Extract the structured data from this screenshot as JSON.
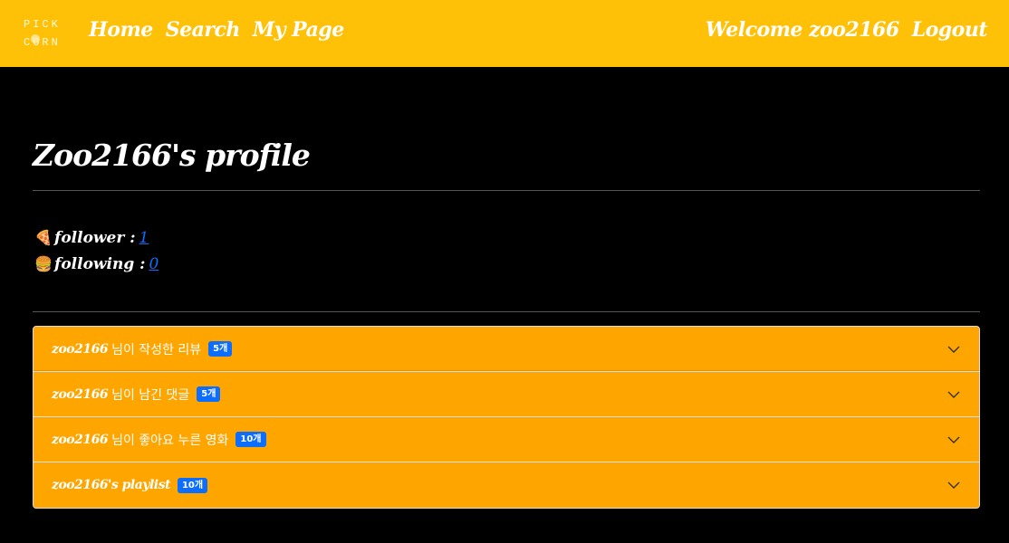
{
  "navbar": {
    "logo_text": "PICK CORN",
    "home": "Home",
    "search": "Search",
    "my_page": "My Page",
    "welcome": "Welcome zoo2166",
    "logout": "Logout"
  },
  "profile": {
    "title": "Zoo2166's profile",
    "follower_label": "follower :",
    "follower_count": "1",
    "following_label": "following :",
    "following_count": "0",
    "follower_icon": "🍕",
    "following_icon": "🍔"
  },
  "accordion": [
    {
      "user": "zoo2166",
      "text": "님이 작성한 리뷰",
      "badge": "5개"
    },
    {
      "user": "zoo2166",
      "text": "님이 남긴 댓글",
      "badge": "5개"
    },
    {
      "user": "zoo2166",
      "text": "님이 좋아요 누른 영화",
      "badge": "10개"
    },
    {
      "user": "zoo2166's playlist",
      "text": "",
      "badge": "10개"
    }
  ],
  "colors": {
    "navbar": "#ffc107",
    "accordion": "#ffa500",
    "badge": "#0d6efd",
    "link": "#0d6efd"
  }
}
